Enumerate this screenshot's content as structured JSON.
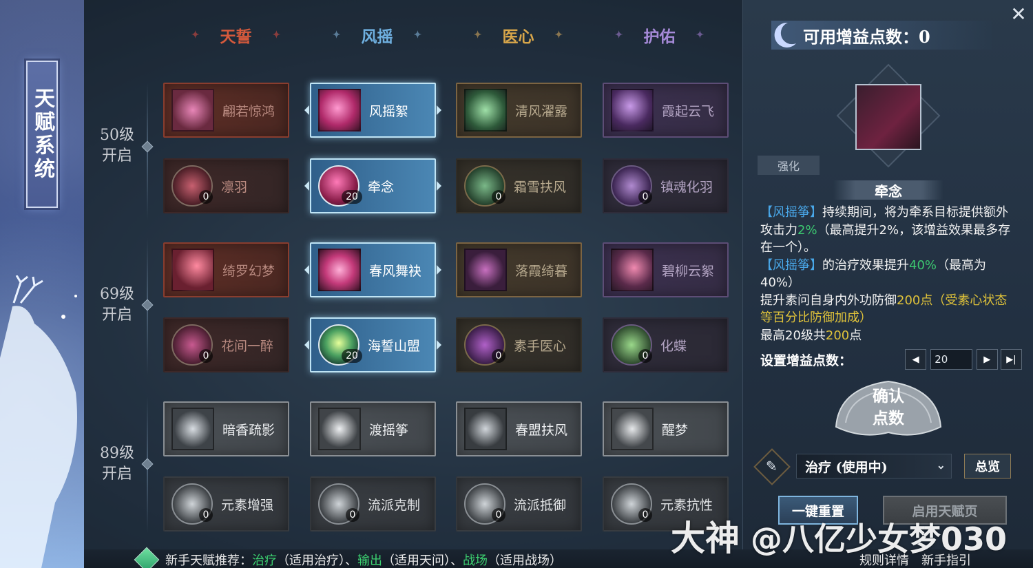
{
  "side_title": "天赋系统",
  "schools": [
    {
      "label": "天誓",
      "color": "#d65a3c"
    },
    {
      "label": "风摇",
      "color": "#6fb0e0"
    },
    {
      "label": "医心",
      "color": "#d8a64a"
    },
    {
      "label": "护佑",
      "color": "#a58ad8"
    }
  ],
  "level_groups": [
    {
      "level": "50级",
      "unlock": "开启"
    },
    {
      "level": "69级",
      "unlock": "开启"
    },
    {
      "level": "89级",
      "unlock": "开启"
    }
  ],
  "talent_rows": [
    [
      {
        "name": "翩若惊鸿"
      },
      {
        "name": "风摇絮"
      },
      {
        "name": "清风濯露"
      },
      {
        "name": "霞起云飞"
      }
    ],
    [
      {
        "name": "凛羽",
        "points": "0"
      },
      {
        "name": "牵念",
        "points": "20"
      },
      {
        "name": "霜雪扶风",
        "points": "0"
      },
      {
        "name": "镇魂化羽",
        "points": "0"
      }
    ],
    [
      {
        "name": "绮罗幻梦"
      },
      {
        "name": "春风舞袂"
      },
      {
        "name": "落霞绮暮"
      },
      {
        "name": "碧柳云絮"
      }
    ],
    [
      {
        "name": "花间一醉",
        "points": "0"
      },
      {
        "name": "海誓山盟",
        "points": "20"
      },
      {
        "name": "素手医心",
        "points": "0"
      },
      {
        "name": "化蝶",
        "points": "0"
      }
    ],
    [
      {
        "name": "暗香疏影"
      },
      {
        "name": "渡摇筝"
      },
      {
        "name": "春盟扶风"
      },
      {
        "name": "醒梦"
      }
    ],
    [
      {
        "name": "元素增强",
        "points": "0"
      },
      {
        "name": "流派克制",
        "points": "0"
      },
      {
        "name": "流派抵御",
        "points": "0"
      },
      {
        "name": "元素抗性",
        "points": "0"
      }
    ]
  ],
  "available_points_label": "可用增益点数：0",
  "selected_skill": {
    "tab": "强化",
    "name": "牵念",
    "desc": {
      "l1_a": "【风摇筝】",
      "l1_b": "持续期间，将为牵系目标提供额外攻击力",
      "l1_c": "2%",
      "l1_d": "（最高提升2%，该增益效果最多存在一个）。",
      "l2_a": "【风摇筝】",
      "l2_b": "的治疗效果提升",
      "l2_c": "40%",
      "l2_d": "（最高为40%）",
      "l3_a": "提升素问自身内外功防御",
      "l3_b": "200点",
      "l3_c": "（受素心状态等百分比防御加成）",
      "l4_a": "最高20级共",
      "l4_b": "200",
      "l4_c": "点"
    }
  },
  "set_points": {
    "label": "设置增益点数：",
    "value": "20",
    "prev": "◀",
    "next": "▶",
    "max": "▶|"
  },
  "confirm": {
    "line1": "确认",
    "line2": "点数"
  },
  "scheme": {
    "selected": "治疗 (使用中)",
    "overview": "总览"
  },
  "reset_label": "一键重置",
  "enable_label": "启用天赋页",
  "tip": {
    "prefix": "新手天赋推荐：",
    "t1": "治疗",
    "t1s": "（适用治疗）、",
    "t2": "输出",
    "t2s": "（适用天问）、",
    "t3": "战场",
    "t3s": "（适用战场）"
  },
  "links": {
    "rules": "规则详情",
    "guide": "新手指引"
  },
  "watermark": {
    "brand": "大神",
    "handle": "@八亿少女梦030"
  },
  "close": "✕"
}
